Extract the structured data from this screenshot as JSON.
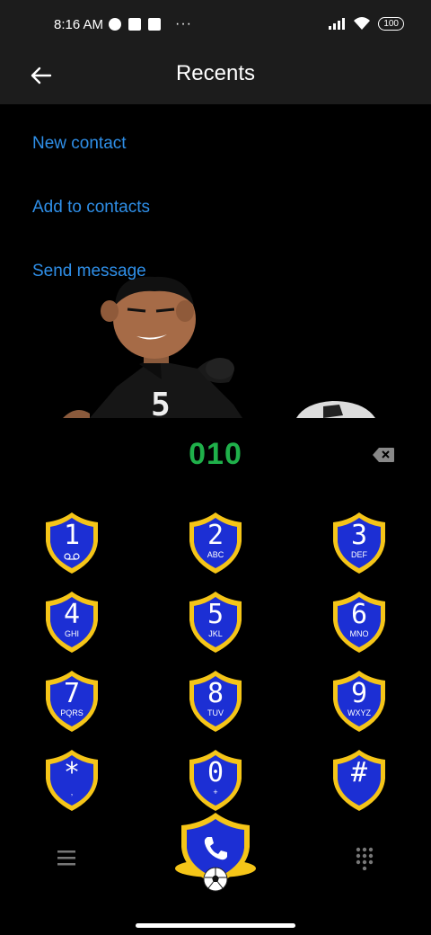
{
  "status_bar": {
    "time": "8:16 AM",
    "battery": "100"
  },
  "app_bar": {
    "title": "Recents"
  },
  "menu": {
    "new_contact": "New contact",
    "add_to_contacts": "Add to contacts",
    "send_message": "Send message"
  },
  "dialer": {
    "number": "010",
    "keys": [
      {
        "digit": "1",
        "letters": ""
      },
      {
        "digit": "2",
        "letters": "ABC"
      },
      {
        "digit": "3",
        "letters": "DEF"
      },
      {
        "digit": "4",
        "letters": "GHI"
      },
      {
        "digit": "5",
        "letters": "JKL"
      },
      {
        "digit": "6",
        "letters": "MNO"
      },
      {
        "digit": "7",
        "letters": "PQRS"
      },
      {
        "digit": "8",
        "letters": "TUV"
      },
      {
        "digit": "9",
        "letters": "WXYZ"
      },
      {
        "digit": "*",
        "letters": ","
      },
      {
        "digit": "0",
        "letters": "+"
      },
      {
        "digit": "#",
        "letters": ""
      }
    ]
  },
  "theme": {
    "accent_blue": "#2f8fe8",
    "number_green": "#1fb04a",
    "shield_blue": "#1c2fd4",
    "shield_gold": "#f5c518"
  },
  "icons": [
    "back-arrow-icon",
    "backspace-icon",
    "menu-icon",
    "dialpad-icon",
    "phone-icon",
    "voicemail-icon",
    "soccer-ball-icon"
  ]
}
